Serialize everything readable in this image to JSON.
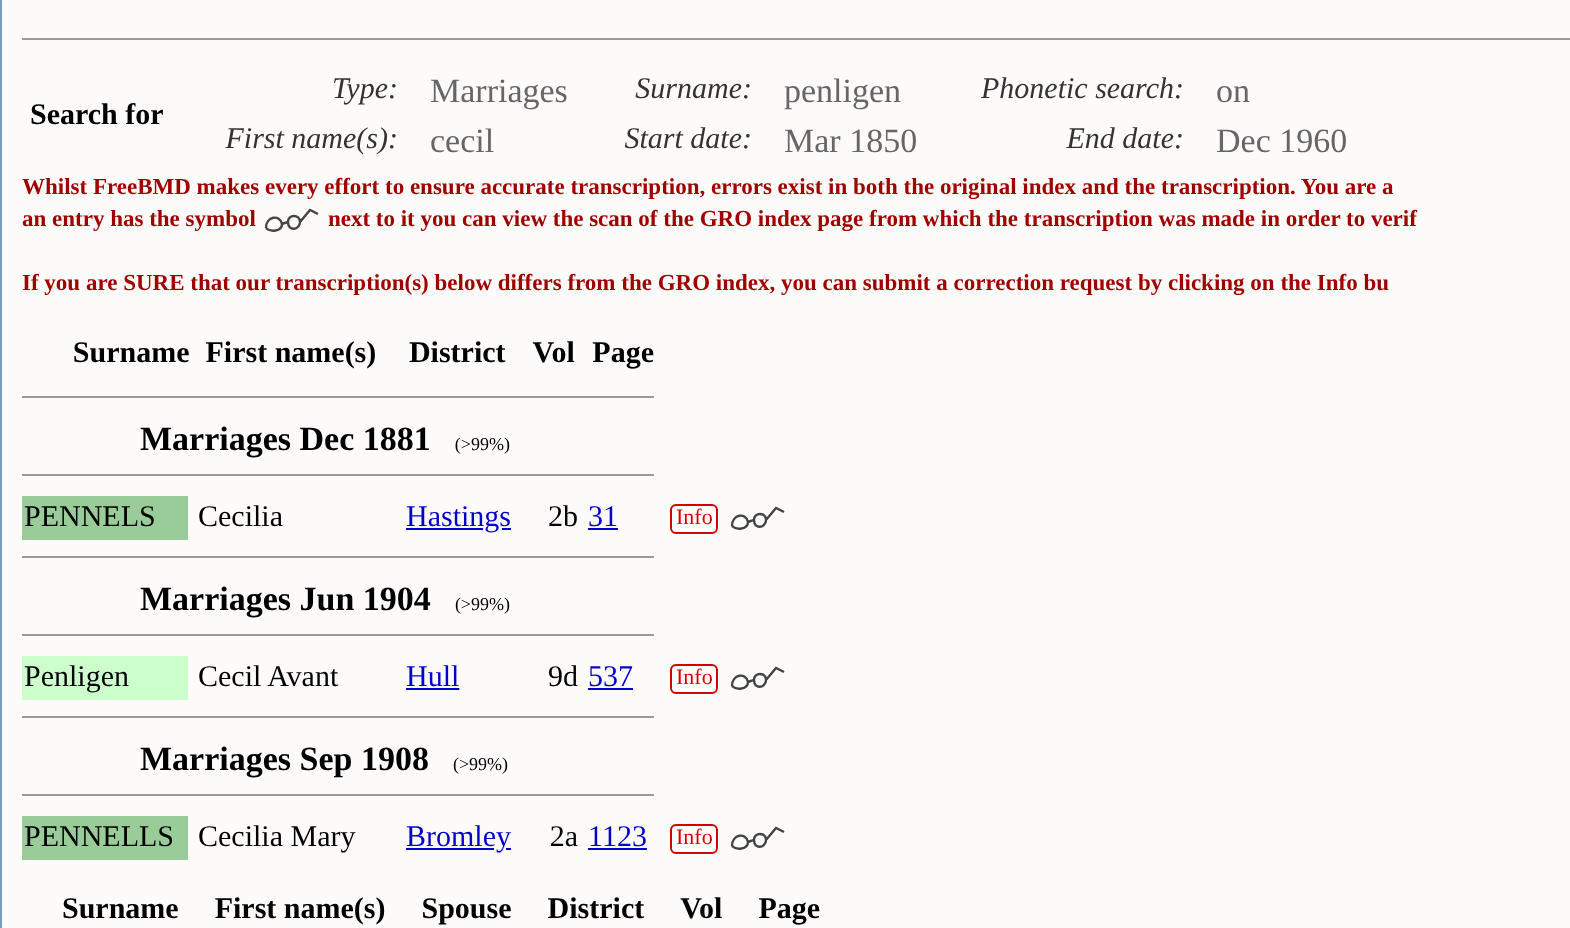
{
  "search": {
    "title": "Search for",
    "fields": [
      {
        "label": "Type:",
        "value": "Marriages"
      },
      {
        "label": "Surname:",
        "value": "penligen"
      },
      {
        "label": "Phonetic search:",
        "value": "on"
      },
      {
        "label": "First name(s):",
        "value": "cecil"
      },
      {
        "label": "Start date:",
        "value": "Mar 1850"
      },
      {
        "label": "End date:",
        "value": "Dec 1960"
      }
    ]
  },
  "notice": {
    "line_1": "Whilst FreeBMD makes every effort to ensure accurate transcription, errors exist in both the original index and the transcription. You are a",
    "line_2_before": "an entry has the symbol",
    "line_2_after": "next to it you can view the scan of the GRO index page from which the transcription was made in order to verif",
    "line_3": "If you are SURE that our transcription(s) below differs from the GRO index, you can submit a correction request by clicking on the Info bu"
  },
  "table": {
    "columns": [
      "Surname",
      "First name(s)",
      "District",
      "Vol",
      "Page"
    ],
    "groups": [
      {
        "title": "Marriages Dec 1881",
        "accuracy": "(>99%)",
        "rows": [
          {
            "surname": "PENNELS",
            "color": "#99cc99",
            "first_names": "Cecilia",
            "district": "Hastings",
            "vol": "2b",
            "page": "31",
            "info": "Info"
          }
        ]
      },
      {
        "title": "Marriages Jun 1904",
        "accuracy": "(>99%)",
        "rows": [
          {
            "surname": "Penligen",
            "color": "#ccffcc",
            "first_names": "Cecil Avant",
            "district": "Hull",
            "vol": "9d",
            "page": "537",
            "info": "Info"
          }
        ]
      },
      {
        "title": "Marriages Sep 1908",
        "accuracy": "(>99%)",
        "rows": [
          {
            "surname": "PENNELLS",
            "color": "#99cc99",
            "first_names": "Cecilia Mary",
            "district": "Bromley",
            "vol": "2a",
            "page": "1123",
            "info": "Info"
          }
        ]
      }
    ]
  },
  "table_2": {
    "columns": [
      "Surname",
      "First name(s)",
      "Spouse",
      "District",
      "Vol",
      "Page"
    ]
  }
}
